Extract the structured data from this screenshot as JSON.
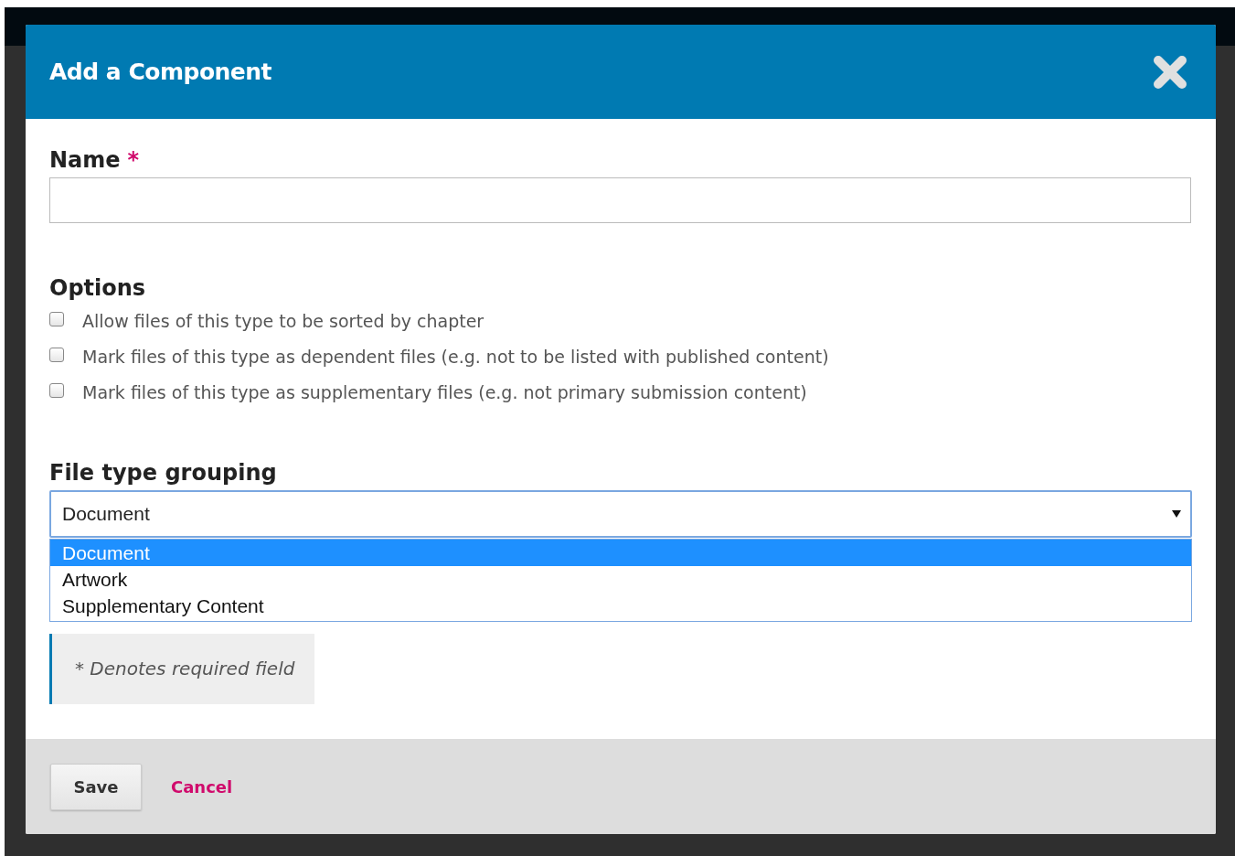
{
  "dialog": {
    "title": "Add a Component"
  },
  "name_field": {
    "label": "Name",
    "required_mark": "*"
  },
  "options": {
    "heading": "Options",
    "items": [
      {
        "label": "Allow files of this type to be sorted by chapter",
        "checked": false
      },
      {
        "label": "Mark files of this type as dependent files (e.g. not to be listed with published content)",
        "checked": false
      },
      {
        "label": "Mark files of this type as supplementary files (e.g. not primary submission content)",
        "checked": false
      }
    ]
  },
  "file_type_grouping": {
    "label": "File type grouping",
    "value": "Document",
    "expanded": true,
    "options": [
      {
        "label": "Document",
        "selected": true
      },
      {
        "label": "Artwork",
        "selected": false
      },
      {
        "label": "Supplementary Content",
        "selected": false
      }
    ]
  },
  "note": "* Denotes required field",
  "buttons": {
    "save": "Save",
    "cancel": "Cancel"
  }
}
